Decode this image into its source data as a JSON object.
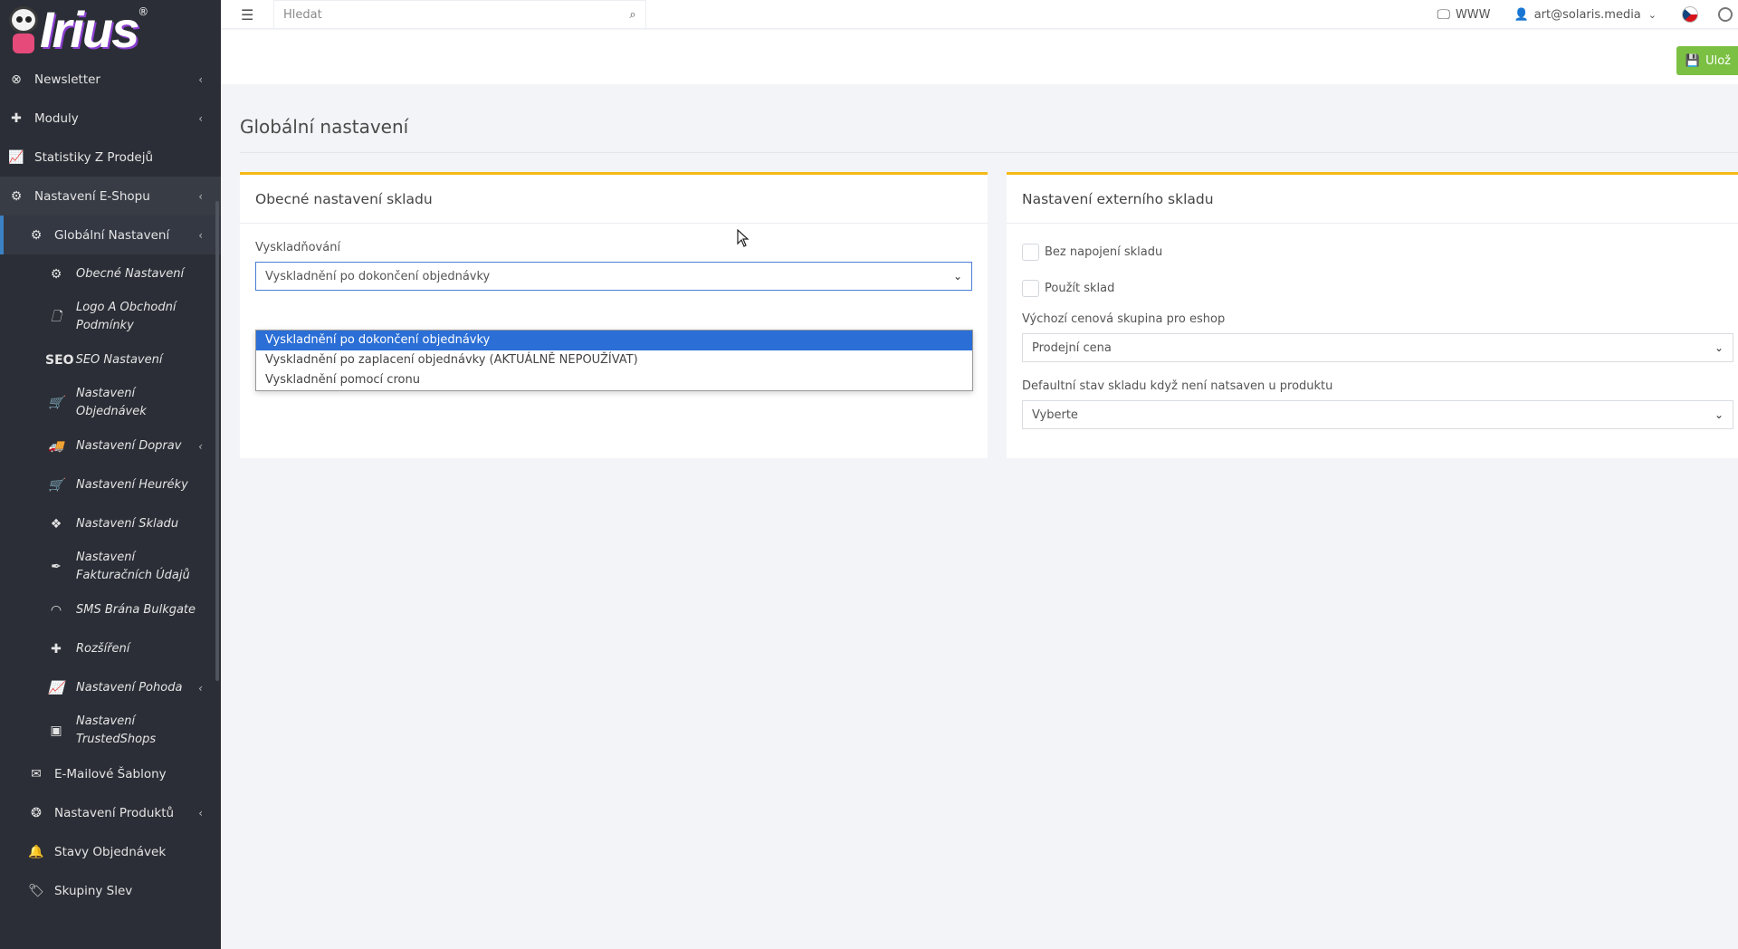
{
  "sidebar": {
    "logo_text": "Irius",
    "logo_reg": "®",
    "items": [
      {
        "label": "Newsletter",
        "icon": "envelope-circle-icon"
      },
      {
        "label": "Moduly",
        "icon": "puzzle-icon"
      },
      {
        "label": "Statistiky Z Prodejů",
        "icon": "line-chart-icon"
      },
      {
        "label": "Nastavení E-Shopu",
        "icon": "cogs-icon"
      },
      {
        "label": "Globální Nastavení",
        "icon": "gear-icon"
      },
      {
        "label": "Obecné Nastavení",
        "icon": "settings-circle-icon"
      },
      {
        "label": "Logo A Obchodní Podmínky",
        "icon": "file-icon"
      },
      {
        "label": "SEO Nastavení",
        "icon": "seo-search-icon",
        "icon_text": "SEO"
      },
      {
        "label": "Nastavení Objednávek",
        "icon": "cart-icon"
      },
      {
        "label": "Nastavení Doprav",
        "icon": "truck-icon"
      },
      {
        "label": "Nastavení Heuréky",
        "icon": "cart-icon"
      },
      {
        "label": "Nastavení Skladu",
        "icon": "dropbox-icon"
      },
      {
        "label": "Nastavení Fakturačních Údajů",
        "icon": "feather-icon"
      },
      {
        "label": "SMS Brána Bulkgate",
        "icon": "signal-icon"
      },
      {
        "label": "Rozšíření",
        "icon": "puzzle-icon"
      },
      {
        "label": "Nastavení Pohoda",
        "icon": "line-chart-icon"
      },
      {
        "label": "Nastavení TrustedShops",
        "icon": "id-card-icon"
      },
      {
        "label": "E-Mailové Šablony",
        "icon": "envelope-icon"
      },
      {
        "label": "Nastavení Produktů",
        "icon": "aperture-icon"
      },
      {
        "label": "Stavy Objednávek",
        "icon": "bell-icon"
      },
      {
        "label": "Skupiny Slev",
        "icon": "tag-icon"
      }
    ]
  },
  "topbar": {
    "search_placeholder": "Hledat",
    "www_label": "WWW",
    "user_email": "art@solaris.media"
  },
  "actionbar": {
    "save_label": "Ulož"
  },
  "page": {
    "title": "Globální nastavení"
  },
  "left_card": {
    "title": "Obecné nastavení skladu",
    "field_label": "Vyskladňování",
    "selected_value": "Vyskladnění po dokončení objednávky",
    "options": [
      "Vyskladnění po dokončení objednávky",
      "Vyskladnění po zaplacení objednávky (AKTUÁLNĚ NEPOUŽÍVAT)",
      "Vyskladnění pomocí cronu"
    ]
  },
  "right_card": {
    "title": "Nastavení externího skladu",
    "checkbox_1": "Bez napojení skladu",
    "checkbox_2": "Použít sklad",
    "price_group_label": "Výchozí cenová skupina pro eshop",
    "price_group_value": "Prodejní cena",
    "default_stock_label": "Defaultní stav skladu když není natsaven u produktu",
    "default_stock_value": "Vyberte"
  },
  "colors": {
    "sidebar_bg": "#2b2e36",
    "card_accent": "#f5b916",
    "save_button": "#7bc043",
    "selected_option": "#2a6ed6"
  }
}
